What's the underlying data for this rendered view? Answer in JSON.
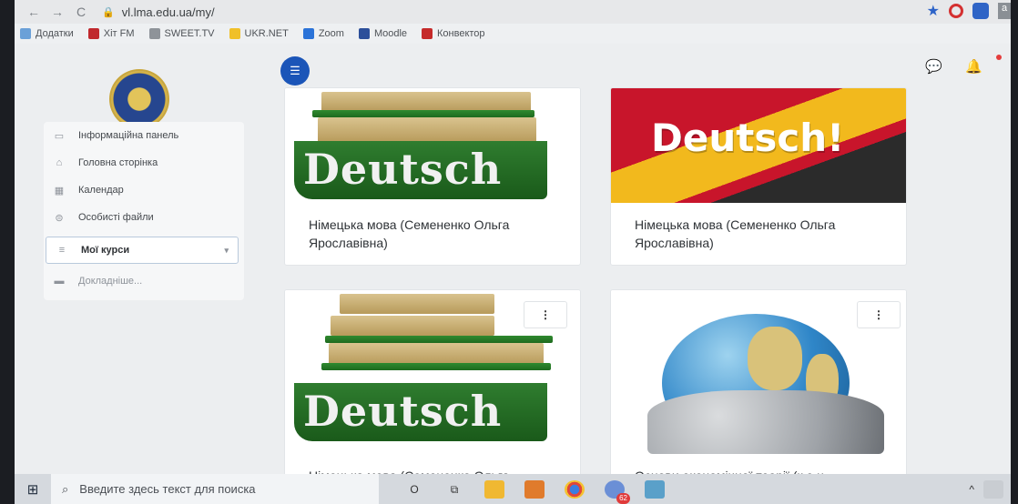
{
  "browser": {
    "back": "←",
    "forward": "→",
    "reload": "C",
    "lock": "🔒",
    "url": "vl.lma.edu.ua/my/",
    "star": "★",
    "ext3": "a"
  },
  "bookmarks": [
    {
      "label": "Додатки",
      "color": "#6aa0d8"
    },
    {
      "label": "Хіт FM",
      "color": "#c0282d"
    },
    {
      "label": "SWEET.TV",
      "color": "#8e9399"
    },
    {
      "label": "UKR.NET",
      "color": "#f0c029"
    },
    {
      "label": "Zoom",
      "color": "#2b73d8"
    },
    {
      "label": "Moodle",
      "color": "#2c4f9a"
    },
    {
      "label": "Конвектор",
      "color": "#c52a2a"
    }
  ],
  "sidebar": {
    "items": [
      {
        "label": "Інформаційна панель",
        "icon": "▭"
      },
      {
        "label": "Головна сторінка",
        "icon": "⌂"
      },
      {
        "label": "Календар",
        "icon": "▦"
      },
      {
        "label": "Особисті файли",
        "icon": "⊜"
      }
    ],
    "active": {
      "label": "Мої курси",
      "icon": "≡",
      "chevron": "▾"
    },
    "more": {
      "label": "Докладніше...",
      "icon": "▬"
    }
  },
  "header": {
    "drawer_icon": "☰",
    "chat_icon": "💬",
    "bell_icon": "🔔"
  },
  "courses": [
    {
      "title": "Німецька мова (Семененко Ольга Ярославівна)",
      "image": "books",
      "word": "Deutsch"
    },
    {
      "title": "Німецька мова (Семененко Ольга Ярославівна)",
      "image": "flag",
      "word": "Deutsch!"
    },
    {
      "title": "Німецька мова (Семененко Ольга",
      "image": "books",
      "word": "Deutsch",
      "menu": "⋮"
    },
    {
      "title": "Основи економічної теорії (к.е.н.",
      "image": "globe",
      "menu": "⋮"
    }
  ],
  "taskbar": {
    "start_icon": "⊞",
    "search_icon": "⌕",
    "search_placeholder": "Введите здесь текст для поиска",
    "cortana": "O",
    "taskview": "⧉",
    "badge": "62",
    "tray_arrow": "^"
  }
}
